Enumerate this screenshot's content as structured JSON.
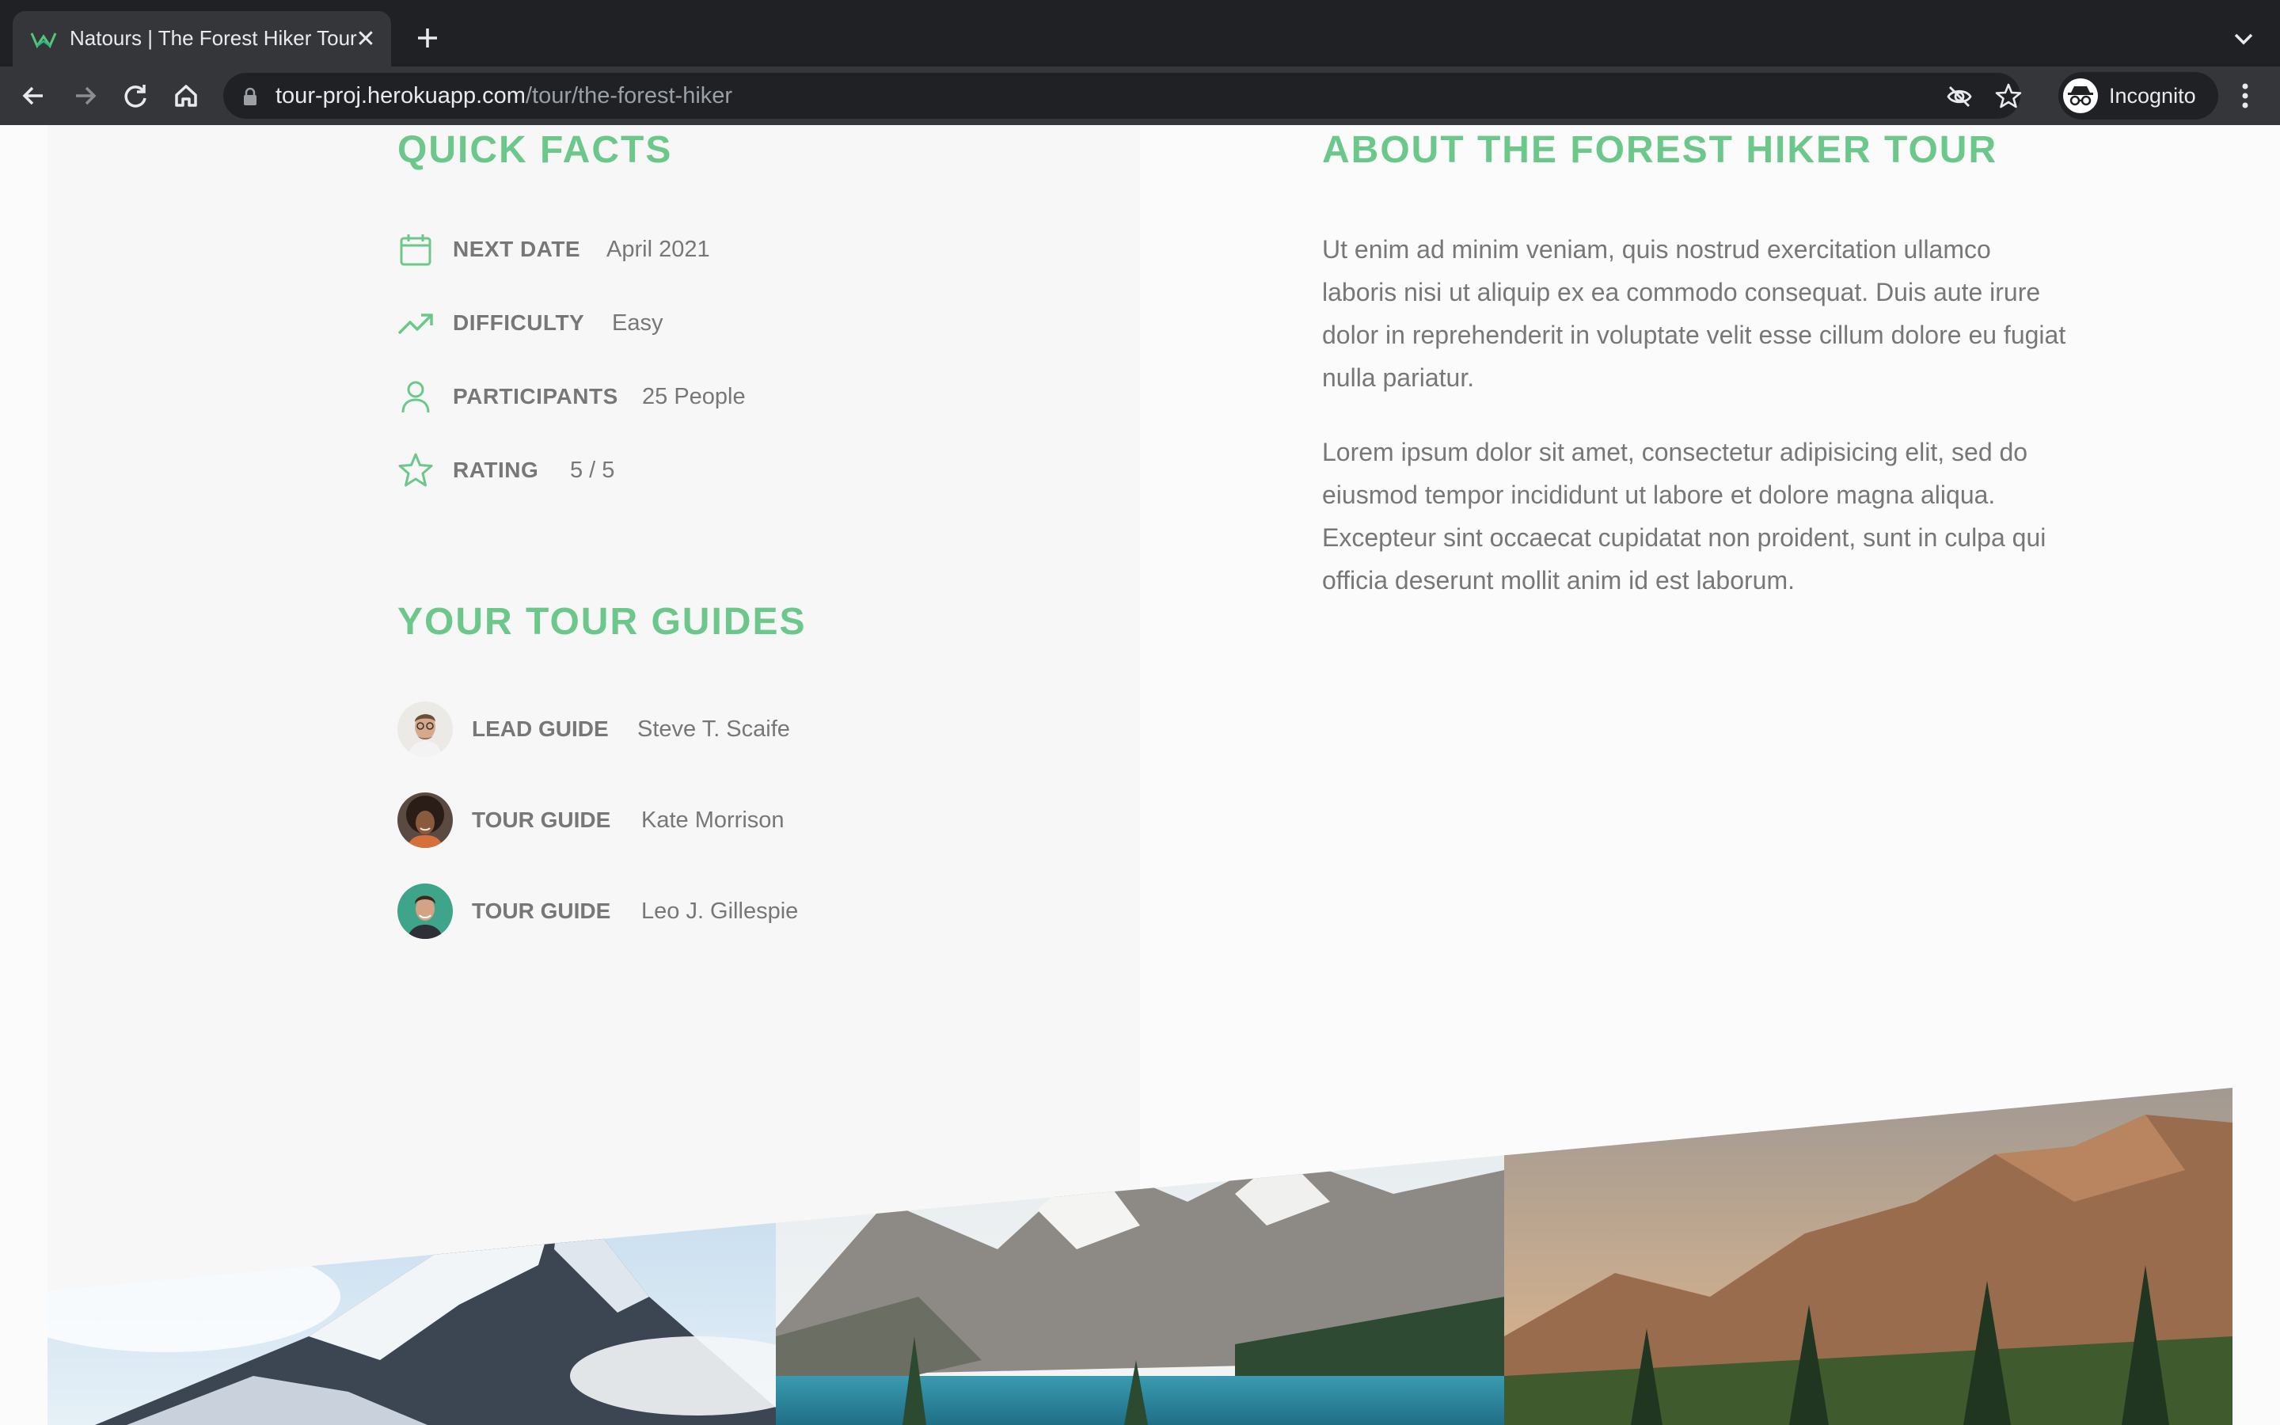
{
  "browser": {
    "tab_title": "Natours | The Forest Hiker Tour",
    "url_host": "tour-proj.herokuapp.com",
    "url_path": "/tour/the-forest-hiker",
    "incognito_label": "Incognito"
  },
  "quick_facts": {
    "heading": "QUICK FACTS",
    "items": [
      {
        "icon": "calendar-icon",
        "label": "NEXT DATE",
        "value": "April 2021"
      },
      {
        "icon": "trending-up-icon",
        "label": "DIFFICULTY",
        "value": "Easy"
      },
      {
        "icon": "user-icon",
        "label": "PARTICIPANTS",
        "value": "25 People"
      },
      {
        "icon": "star-icon",
        "label": "RATING",
        "value": "5 / 5"
      }
    ]
  },
  "guides": {
    "heading": "YOUR TOUR GUIDES",
    "items": [
      {
        "role": "LEAD GUIDE",
        "name": "Steve T. Scaife"
      },
      {
        "role": "TOUR GUIDE",
        "name": "Kate Morrison"
      },
      {
        "role": "TOUR GUIDE",
        "name": "Leo J. Gillespie"
      }
    ]
  },
  "about": {
    "heading": "ABOUT THE FOREST HIKER TOUR",
    "paragraphs": [
      "Ut enim ad minim veniam, quis nostrud exercitation ullamco laboris nisi ut aliquip ex ea commodo consequat. Duis aute irure dolor in reprehenderit in voluptate velit esse cillum dolore eu fugiat nulla pariatur.",
      "Lorem ipsum dolor sit amet, consectetur adipisicing elit, sed do eiusmod tempor incididunt ut labore et dolore magna aliqua. Excepteur sint occaecat cupidatat non proident, sunt in culpa qui officia deserunt mollit anim id est laborum."
    ]
  },
  "colors": {
    "accent": "#6cc88a",
    "text": "#777777",
    "chrome_dark": "#202124",
    "chrome_mid": "#35363a"
  }
}
